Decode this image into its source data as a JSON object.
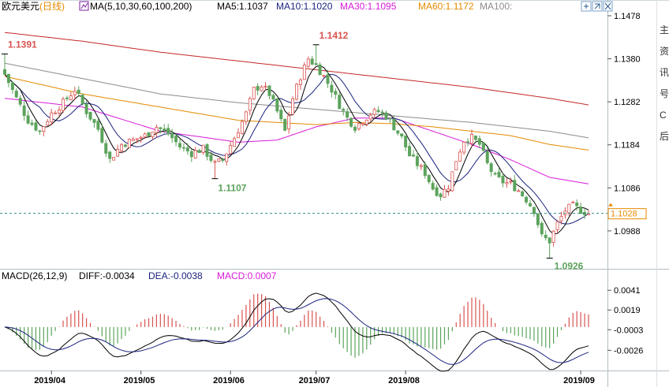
{
  "header": {
    "instrument": "欧元美元",
    "period": "(日线)",
    "ma_label": "MA(5,10,30,60,100,200)",
    "ma5": "MA5:1.1037",
    "ma10": "MA10:1.1020",
    "ma30": "MA30:1.1095",
    "ma60": "MA60:1.1172",
    "ma100": "MA100:"
  },
  "macd_header": {
    "label": "MACD(26,12,9)",
    "diff": "DIFF:-0.0034",
    "dea": "DEA:-0.0038",
    "macd": "MACD:0.0007"
  },
  "price_axis": {
    "ticks": [
      "1.1478",
      "1.1380",
      "1.1282",
      "1.1184",
      "1.1086",
      "1.0988"
    ],
    "current": "1.1028"
  },
  "macd_axis": {
    "ticks": [
      "0.0041",
      "0.0019",
      "-0.0003",
      "-0.0026"
    ]
  },
  "annotations": {
    "high1": "1.1391",
    "high2": "1.1412",
    "low1": "1.1107",
    "low2": "1.0926"
  },
  "date_labels": [
    "2019/04",
    "2019/05",
    "2019/06",
    "2019/07",
    "2019/08",
    "2019/09"
  ],
  "side_text": [
    "主",
    "资",
    "讯",
    "号",
    "C",
    "后"
  ],
  "icons": [
    "expand-icon",
    "collapse-icon",
    "close-icon"
  ],
  "colors": {
    "up": "#d9534f",
    "down": "#5ca35c",
    "ma5": "#000000",
    "ma10": "#1a237e",
    "ma30": "#d81bd8",
    "ma60": "#e58a00",
    "ma100": "#8c8c8c",
    "ma200": "#c62828",
    "diff": "#000000",
    "dea": "#1a237e"
  },
  "chart_data": [
    {
      "type": "candlestick",
      "title": "欧元美元(日线)",
      "x_labels": [
        "2019/04",
        "2019/05",
        "2019/06",
        "2019/07",
        "2019/08",
        "2019/09"
      ],
      "ylim": [
        1.0925,
        1.1478
      ],
      "grid": false,
      "current_price": 1.1028,
      "anchors": [
        {
          "i": 0,
          "c": 1.1345
        },
        {
          "i": 3,
          "c": 1.129
        },
        {
          "i": 6,
          "c": 1.124
        },
        {
          "i": 9,
          "c": 1.1215
        },
        {
          "i": 12,
          "c": 1.1255
        },
        {
          "i": 15,
          "c": 1.128
        },
        {
          "i": 18,
          "c": 1.131
        },
        {
          "i": 21,
          "c": 1.126
        },
        {
          "i": 24,
          "c": 1.122
        },
        {
          "i": 27,
          "c": 1.115
        },
        {
          "i": 30,
          "c": 1.1185
        },
        {
          "i": 33,
          "c": 1.1195
        },
        {
          "i": 36,
          "c": 1.1205
        },
        {
          "i": 39,
          "c": 1.1225
        },
        {
          "i": 42,
          "c": 1.121
        },
        {
          "i": 45,
          "c": 1.118
        },
        {
          "i": 48,
          "c": 1.1165
        },
        {
          "i": 51,
          "c": 1.1175
        },
        {
          "i": 54,
          "c": 1.114
        },
        {
          "i": 56,
          "c": 1.115
        },
        {
          "i": 59,
          "c": 1.12
        },
        {
          "i": 62,
          "c": 1.1255
        },
        {
          "i": 64,
          "c": 1.131
        },
        {
          "i": 66,
          "c": 1.132
        },
        {
          "i": 68,
          "c": 1.13
        },
        {
          "i": 70,
          "c": 1.126
        },
        {
          "i": 72,
          "c": 1.1215
        },
        {
          "i": 74,
          "c": 1.129
        },
        {
          "i": 76,
          "c": 1.134
        },
        {
          "i": 78,
          "c": 1.138
        },
        {
          "i": 80,
          "c": 1.1365
        },
        {
          "i": 82,
          "c": 1.134
        },
        {
          "i": 84,
          "c": 1.131
        },
        {
          "i": 86,
          "c": 1.1275
        },
        {
          "i": 88,
          "c": 1.1245
        },
        {
          "i": 90,
          "c": 1.1225
        },
        {
          "i": 92,
          "c": 1.124
        },
        {
          "i": 94,
          "c": 1.1255
        },
        {
          "i": 96,
          "c": 1.126
        },
        {
          "i": 98,
          "c": 1.125
        },
        {
          "i": 100,
          "c": 1.1225
        },
        {
          "i": 102,
          "c": 1.12
        },
        {
          "i": 104,
          "c": 1.116
        },
        {
          "i": 106,
          "c": 1.114
        },
        {
          "i": 108,
          "c": 1.112
        },
        {
          "i": 110,
          "c": 1.1085
        },
        {
          "i": 112,
          "c": 1.107
        },
        {
          "i": 114,
          "c": 1.109
        },
        {
          "i": 116,
          "c": 1.115
        },
        {
          "i": 118,
          "c": 1.1195
        },
        {
          "i": 120,
          "c": 1.12
        },
        {
          "i": 122,
          "c": 1.1185
        },
        {
          "i": 124,
          "c": 1.114
        },
        {
          "i": 126,
          "c": 1.111
        },
        {
          "i": 128,
          "c": 1.11
        },
        {
          "i": 130,
          "c": 1.1095
        },
        {
          "i": 132,
          "c": 1.108
        },
        {
          "i": 134,
          "c": 1.106
        },
        {
          "i": 136,
          "c": 1.1035
        },
        {
          "i": 138,
          "c": 1.0975
        },
        {
          "i": 140,
          "c": 1.0965
        },
        {
          "i": 142,
          "c": 1.1005
        },
        {
          "i": 144,
          "c": 1.1035
        },
        {
          "i": 146,
          "c": 1.1045
        },
        {
          "i": 148,
          "c": 1.1035
        },
        {
          "i": 150,
          "c": 1.1028
        }
      ],
      "ma_series": [
        {
          "name": "MA30",
          "points": [
            [
              0,
              1.129
            ],
            [
              20,
              1.127
            ],
            [
              40,
              1.1215
            ],
            [
              60,
              1.119
            ],
            [
              70,
              1.1195
            ],
            [
              80,
              1.1225
            ],
            [
              90,
              1.1245
            ],
            [
              100,
              1.1245
            ],
            [
              110,
              1.1215
            ],
            [
              120,
              1.1185
            ],
            [
              130,
              1.115
            ],
            [
              140,
              1.111
            ],
            [
              150,
              1.1095
            ]
          ]
        },
        {
          "name": "MA60",
          "points": [
            [
              0,
              1.134
            ],
            [
              20,
              1.13
            ],
            [
              40,
              1.127
            ],
            [
              60,
              1.124
            ],
            [
              80,
              1.123
            ],
            [
              90,
              1.1235
            ],
            [
              100,
              1.1232
            ],
            [
              110,
              1.1225
            ],
            [
              120,
              1.1215
            ],
            [
              130,
              1.1205
            ],
            [
              140,
              1.1185
            ],
            [
              150,
              1.1172
            ]
          ]
        },
        {
          "name": "MA100",
          "points": [
            [
              0,
              1.137
            ],
            [
              20,
              1.1335
            ],
            [
              40,
              1.13
            ],
            [
              60,
              1.128
            ],
            [
              80,
              1.1265
            ],
            [
              100,
              1.125
            ],
            [
              120,
              1.1235
            ],
            [
              140,
              1.1215
            ],
            [
              150,
              1.12
            ]
          ]
        },
        {
          "name": "MA200",
          "points": [
            [
              0,
              1.144
            ],
            [
              20,
              1.142
            ],
            [
              40,
              1.1395
            ],
            [
              60,
              1.1375
            ],
            [
              80,
              1.1355
            ],
            [
              100,
              1.1335
            ],
            [
              120,
              1.1315
            ],
            [
              140,
              1.129
            ],
            [
              150,
              1.1275
            ]
          ]
        }
      ],
      "labels": [
        {
          "text": "1.1391",
          "value": 1.1391
        },
        {
          "text": "1.1412",
          "value": 1.1412
        },
        {
          "text": "1.1107",
          "value": 1.1107
        },
        {
          "text": "1.0926",
          "value": 1.0926
        }
      ]
    },
    {
      "type": "bar",
      "title": "MACD(26,12,9)",
      "ylim": [
        -0.0045,
        0.005
      ],
      "series": [
        {
          "name": "DIFF",
          "value": -0.0034
        },
        {
          "name": "DEA",
          "value": -0.0038
        },
        {
          "name": "MACD",
          "value": 0.0007
        }
      ]
    }
  ]
}
